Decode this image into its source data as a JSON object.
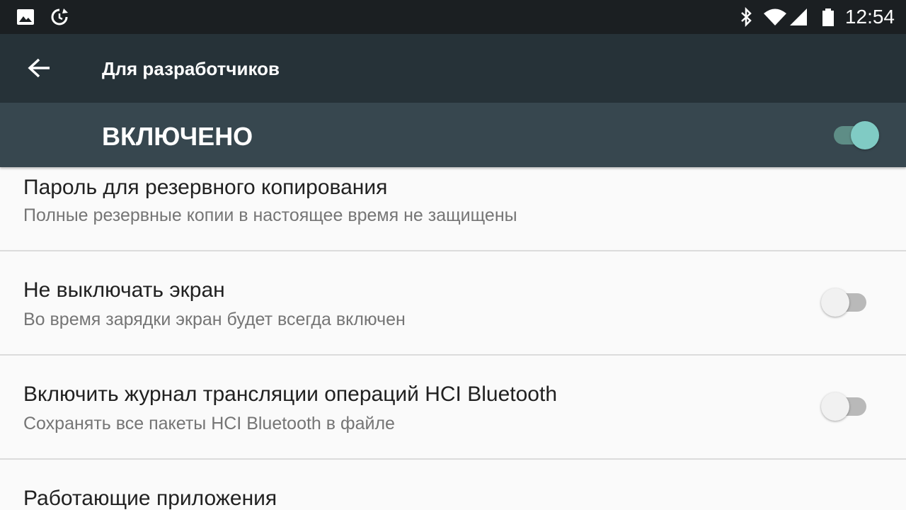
{
  "status_bar": {
    "time": "12:54",
    "icons": [
      "image-icon",
      "sync-icon",
      "bluetooth-icon",
      "wifi-icon",
      "signal-icon",
      "battery-icon"
    ]
  },
  "toolbar": {
    "title": "Для разработчиков"
  },
  "master_switch": {
    "label": "ВКЛЮЧЕНО",
    "on": true
  },
  "settings": [
    {
      "title": "Пароль для резервного копирования",
      "summary": "Полные резервные копии в настоящее время не защищены"
    },
    {
      "title": "Не выключать экран",
      "summary": "Во время зарядки экран будет всегда включен",
      "toggle": false
    },
    {
      "title": "Включить журнал трансляции операций HCI Bluetooth",
      "summary": "Сохранять все пакеты HCI Bluetooth в файле",
      "toggle": false
    },
    {
      "title": "Работающие приложения"
    }
  ],
  "colors": {
    "status_bar": "#1b1f22",
    "toolbar": "#263238",
    "master_bar": "#37474f",
    "accent": "#80cbc4"
  }
}
